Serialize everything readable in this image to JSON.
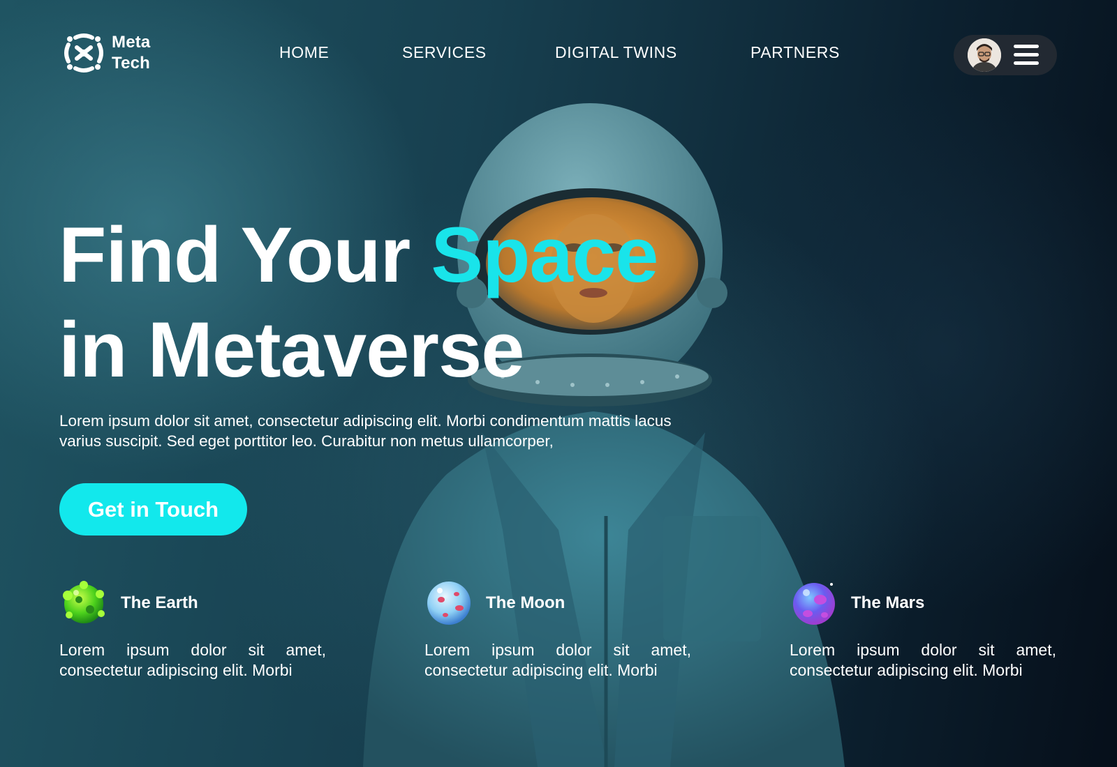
{
  "brand": {
    "line1": "Meta",
    "line2": "Tech"
  },
  "nav": {
    "items": [
      {
        "label": "HOME"
      },
      {
        "label": "SERVICES"
      },
      {
        "label": "DIGITAL TWINS"
      },
      {
        "label": "PARTNERS"
      }
    ]
  },
  "hero": {
    "title_line1_prefix": "Find Your ",
    "title_line1_accent": "Space",
    "title_line2": "in Metaverse",
    "description": "Lorem ipsum dolor sit amet, consectetur adipiscing elit. Morbi condimentum mattis lacus varius suscipit. Sed eget porttitor leo. Curabitur non metus ullamcorper,",
    "cta_label": "Get in Touch"
  },
  "planets": [
    {
      "title": "The Earth",
      "text": "Lorem ipsum dolor sit amet, consectetur adipiscing elit. Morbi"
    },
    {
      "title": "The Moon",
      "text": "Lorem ipsum dolor sit amet, consectetur adipiscing elit. Morbi"
    },
    {
      "title": "The Mars",
      "text": "Lorem ipsum dolor sit amet, consectetur adipiscing elit. Morbi"
    }
  ],
  "colors": {
    "accent": "#19e4ea",
    "cta_background": "#12e8ec",
    "background_dark": "#060f1a",
    "background_teal": "#1f5462",
    "text": "#ffffff"
  },
  "icons": {
    "logo": "network-logo-icon",
    "menu": "hamburger-menu-icon",
    "avatar": "user-avatar"
  }
}
